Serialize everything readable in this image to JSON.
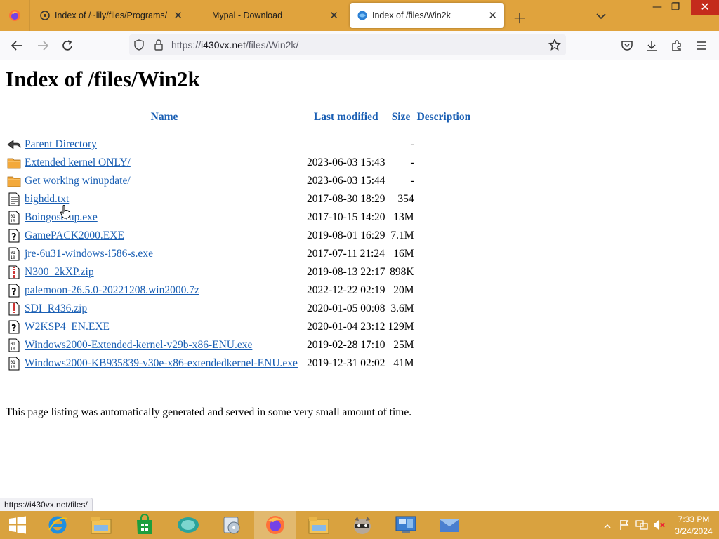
{
  "browser": {
    "tabs": [
      {
        "title": "Index of /~lily/files/Programs/"
      },
      {
        "title": "Mypal - Download"
      },
      {
        "title": "Index of /files/Win2k"
      }
    ],
    "url_prefix": "https://",
    "url_host": "i430vx.net",
    "url_path": "/files/Win2k/",
    "status_url": "https://i430vx.net/files/"
  },
  "page": {
    "heading": "Index of /files/Win2k",
    "columns": {
      "name": "Name",
      "modified": "Last modified",
      "size": "Size",
      "description": "Description"
    },
    "rows": [
      {
        "icon": "back-icon",
        "name": "Parent Directory",
        "modified": "",
        "size": "-"
      },
      {
        "icon": "folder-icon",
        "name": "Extended kernel ONLY/",
        "modified": "2023-06-03 15:43",
        "size": "-"
      },
      {
        "icon": "folder-icon",
        "name": "Get working winupdate/",
        "modified": "2023-06-03 15:44",
        "size": "-"
      },
      {
        "icon": "text-file-icon",
        "name": "bighdd.txt",
        "modified": "2017-08-30 18:29",
        "size": "354"
      },
      {
        "icon": "binary-file-icon",
        "name": "Boingosetup.exe",
        "modified": "2017-10-15 14:20",
        "size": "13M"
      },
      {
        "icon": "unknown-file-icon",
        "name": "GamePACK2000.EXE",
        "modified": "2019-08-01 16:29",
        "size": "7.1M"
      },
      {
        "icon": "binary-file-icon",
        "name": "jre-6u31-windows-i586-s.exe",
        "modified": "2017-07-11 21:24",
        "size": "16M"
      },
      {
        "icon": "compressed-file-icon",
        "name": "N300_2kXP.zip",
        "modified": "2019-08-13 22:17",
        "size": "898K"
      },
      {
        "icon": "unknown-file-icon",
        "name": "palemoon-26.5.0-20221208.win2000.7z",
        "modified": "2022-12-22 02:19",
        "size": "20M"
      },
      {
        "icon": "compressed-file-icon",
        "name": "SDI_R436.zip",
        "modified": "2020-01-05 00:08",
        "size": "3.6M"
      },
      {
        "icon": "unknown-file-icon",
        "name": "W2KSP4_EN.EXE",
        "modified": "2020-01-04 23:12",
        "size": "129M"
      },
      {
        "icon": "binary-file-icon",
        "name": "Windows2000-Extended-kernel-v29b-x86-ENU.exe",
        "modified": "2019-02-28 17:10",
        "size": "25M"
      },
      {
        "icon": "binary-file-icon",
        "name": "Windows2000-KB935839-v30e-x86-extendedkernel-ENU.exe",
        "modified": "2019-12-31 02:02",
        "size": "41M"
      }
    ],
    "footer": "This page listing was automatically generated and served in some very small amount of time."
  },
  "taskbar": {
    "items": [
      "start-icon",
      "internet-explorer-icon",
      "file-explorer-icon",
      "store-icon",
      "messenger-icon",
      "media-player-icon",
      "firefox-icon",
      "file-explorer-icon",
      "raccoon-app-icon",
      "control-panel-icon",
      "mail-app-icon"
    ],
    "time": "7:33 PM",
    "date": "3/24/2024"
  },
  "colors": {
    "tabbar": "#e0a33d",
    "taskbar": "#d9a23f",
    "link": "#1a5fb4",
    "close": "#c42b1c"
  }
}
